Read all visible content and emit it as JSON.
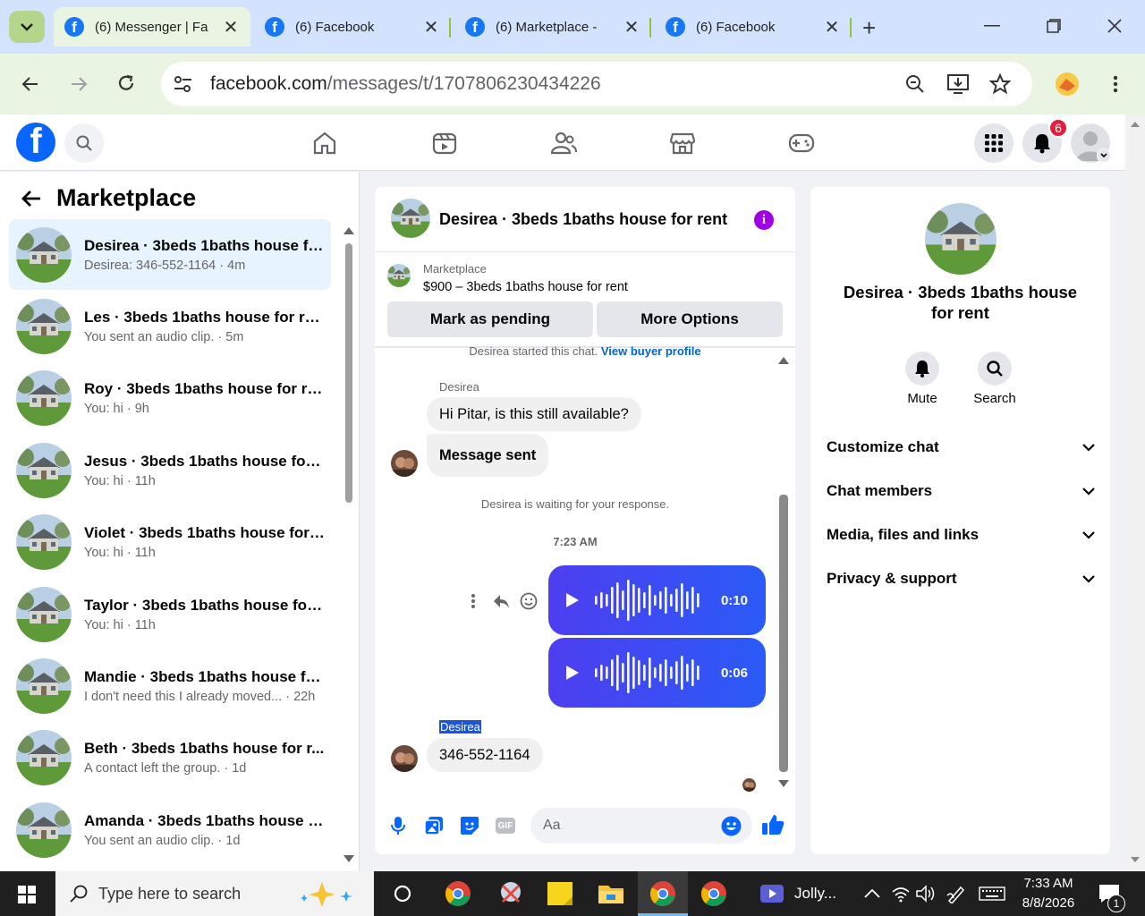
{
  "browser": {
    "tabs": [
      {
        "title": "(6) Messenger | Fa",
        "active": true
      },
      {
        "title": "(6) Facebook"
      },
      {
        "title": "(6) Marketplace -"
      },
      {
        "title": "(6) Facebook"
      }
    ],
    "url_domain": "facebook.com",
    "url_path": "/messages/t/1707806230434226"
  },
  "fb": {
    "logo": "f",
    "notification_count": "6"
  },
  "sidebar": {
    "title": "Marketplace",
    "conversations": [
      {
        "name": "Desirea · 3beds 1baths house fo...",
        "preview": "Desirea: 346-552-1164 · 4m",
        "selected": true
      },
      {
        "name": "Les · 3beds 1baths house for rent",
        "preview": "You sent an audio clip. · 5m"
      },
      {
        "name": "Roy · 3beds 1baths house for rent",
        "preview": "You: hi · 9h"
      },
      {
        "name": "Jesus · 3beds 1baths house for r...",
        "preview": "You: hi · 11h"
      },
      {
        "name": "Violet · 3beds 1baths house for ...",
        "preview": "You: hi · 11h"
      },
      {
        "name": "Taylor · 3beds 1baths house for ...",
        "preview": "You: hi · 11h"
      },
      {
        "name": "Mandie · 3beds 1baths house fo...",
        "preview": "I don't need this I already moved... · 22h"
      },
      {
        "name": "Beth · 3beds 1baths house for r...",
        "preview": "A contact left the group. · 1d"
      },
      {
        "name": "Amanda · 3beds 1baths house f...",
        "preview": "You sent an audio clip. · 1d"
      }
    ]
  },
  "chat": {
    "header_title": "Desirea · 3beds 1baths house for rent",
    "listing_label": "Marketplace",
    "listing_text": "$900 – 3beds 1baths house for rent",
    "mark_pending": "Mark as pending",
    "more_options": "More Options",
    "started_text": "Desirea started this chat.",
    "view_profile": "View buyer profile",
    "sender1": "Desirea",
    "msg1": "Hi Pitar, is this still available?",
    "msg2": "Message sent",
    "waiting": "Desirea is waiting for your response.",
    "time": "7:23 AM",
    "audio1": "0:10",
    "audio2": "0:06",
    "sender2": "Desirea",
    "msg3": "346-552-1164",
    "composer_placeholder": "Aa",
    "gif": "GIF"
  },
  "info": {
    "title": "Desirea · 3beds 1baths house for rent",
    "mute": "Mute",
    "search": "Search",
    "rows": [
      "Customize chat",
      "Chat members",
      "Media, files and links",
      "Privacy & support"
    ]
  },
  "taskbar": {
    "search_placeholder": "Type here to search",
    "app_label": "Jolly...",
    "time": "7:33 AM",
    "date": "8/8/2026",
    "notif": "1"
  }
}
